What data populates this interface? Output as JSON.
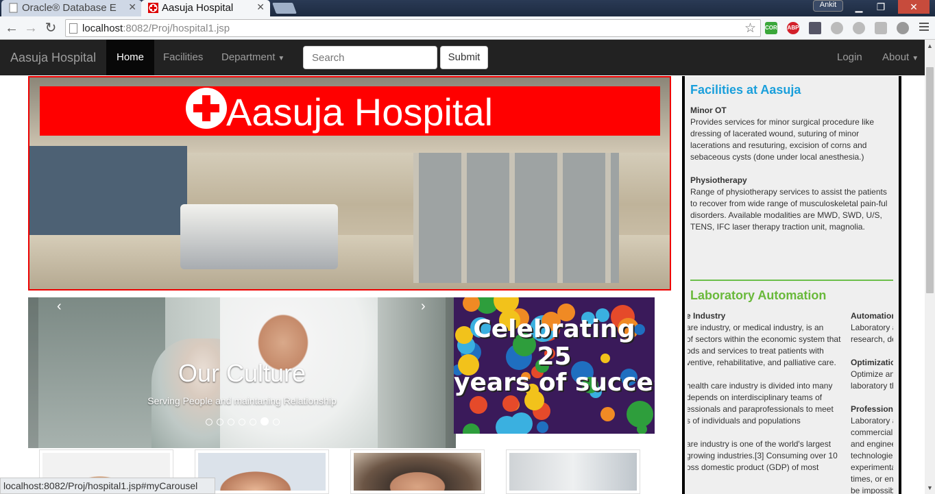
{
  "browser": {
    "tabs": [
      {
        "label": "Oracle® Database E",
        "active": false
      },
      {
        "label": "Aasuja Hospital",
        "active": true
      }
    ],
    "user_badge": "Ankit",
    "url_host": "localhost",
    "url_rest": ":8082/Proj/hospital1.jsp",
    "extensions": [
      "CORS",
      "ABP"
    ],
    "status_url": "localhost:8082/Proj/hospital1.jsp#myCarousel"
  },
  "navbar": {
    "brand": "Aasuja Hospital",
    "items": [
      {
        "label": "Home",
        "active": true
      },
      {
        "label": "Facilities",
        "active": false
      },
      {
        "label": "Department",
        "active": false,
        "dropdown": true
      }
    ],
    "search_placeholder": "Search",
    "submit_label": "Submit",
    "right": [
      {
        "label": "Login"
      },
      {
        "label": "About",
        "dropdown": true
      }
    ]
  },
  "hero": {
    "banner_text": "Aasuja Hospital",
    "banner_color": "#ff0000"
  },
  "carousel": {
    "title": "Our Culture",
    "subtitle": "Serving People and maintaning Relationship",
    "prev": "‹",
    "next": "›",
    "indicator_count": 7,
    "active_index": 5
  },
  "celebration": {
    "line1": "Celebrating",
    "line2": "25",
    "line3": "years of success"
  },
  "sidebar": {
    "facilities_title": "Facilities at Aasuja",
    "facilities": [
      {
        "name": "Minor OT",
        "text": "Provides services for minor surgical procedure like dressing of lacerated wound, suturing of minor lacerations and resuturing, excision of corns and sebaceous cysts (done under local anesthesia.)"
      },
      {
        "name": "Physiotherapy",
        "text": "Range of physiotherapy services to assist the patients to recover from wide range of musculoskeletal pain-ful disorders. Available modalities are MWD, SWD, U/S, TENS, IFC laser therapy traction unit, magnolia."
      }
    ],
    "lab_title": "Laboratory Automation",
    "lab_left": [
      {
        "heading": "e Industry",
        "lines": [
          "are industry, or medical industry, is an",
          "of sectors within the economic system that",
          "ods and services to treat patients with",
          "ventive, rehabilitative, and palliative care."
        ]
      },
      {
        "heading": "",
        "lines": [
          "health care industry is divided into many",
          "depends on interdisciplinary teams of",
          "essionals and paraprofessionals to meet",
          "s of individuals and populations"
        ]
      },
      {
        "heading": "",
        "lines": [
          "are industry is one of the world's largest",
          "growing industries.[3] Consuming over 10",
          "oss domestic product (GDP) of most"
        ]
      }
    ],
    "lab_right": [
      {
        "heading": "Automation",
        "lines": [
          "Laboratory a",
          "research, de"
        ]
      },
      {
        "heading": "Optimization",
        "lines": [
          "Optimize and",
          "laboratory th"
        ]
      },
      {
        "heading": "Professional",
        "lines": [
          "Laboratory a",
          "commercial",
          "and enginee",
          "technologies",
          "experimenta",
          "times, or ena",
          "be impossib"
        ]
      }
    ]
  }
}
